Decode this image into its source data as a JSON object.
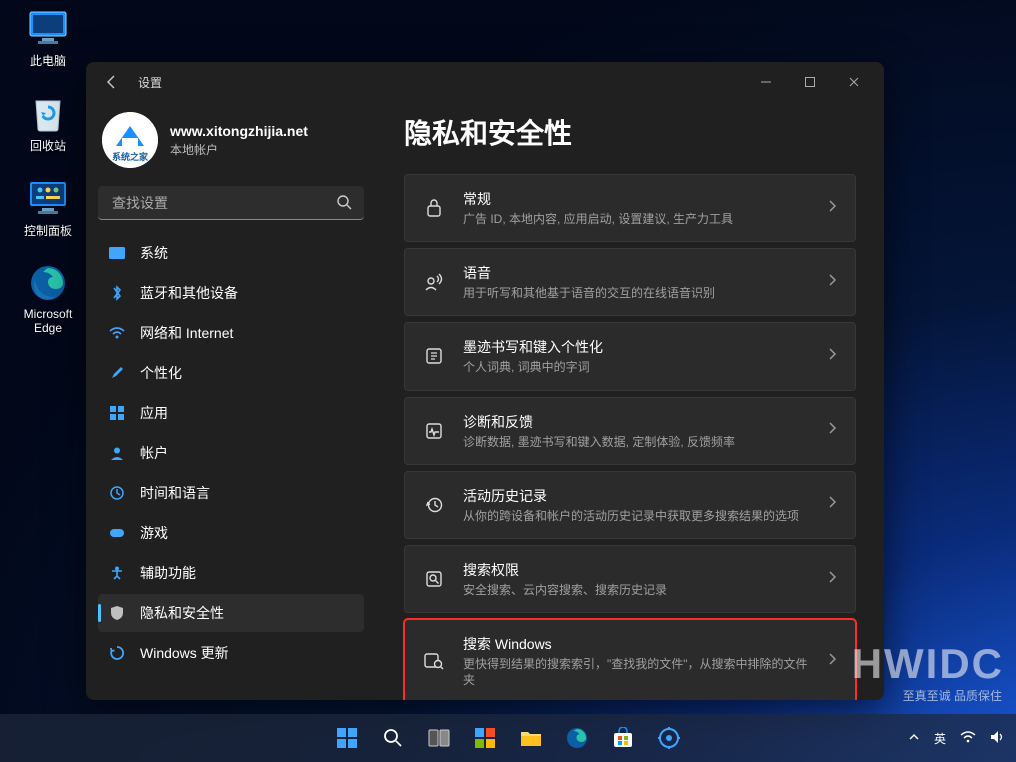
{
  "desktop": {
    "items": [
      {
        "name": "此电脑"
      },
      {
        "name": "回收站"
      },
      {
        "name": "控制面板"
      },
      {
        "name": "Microsoft Edge"
      }
    ]
  },
  "window": {
    "title": "设置",
    "account": {
      "username": "www.xitongzhijia.net",
      "type": "本地帐户"
    },
    "search_placeholder": "查找设置"
  },
  "sidebar": {
    "items": [
      {
        "label": "系统"
      },
      {
        "label": "蓝牙和其他设备"
      },
      {
        "label": "网络和 Internet"
      },
      {
        "label": "个性化"
      },
      {
        "label": "应用"
      },
      {
        "label": "帐户"
      },
      {
        "label": "时间和语言"
      },
      {
        "label": "游戏"
      },
      {
        "label": "辅助功能"
      },
      {
        "label": "隐私和安全性"
      },
      {
        "label": "Windows 更新"
      }
    ]
  },
  "main": {
    "heading": "隐私和安全性",
    "cards": [
      {
        "title": "常规",
        "sub": "广告 ID, 本地内容, 应用启动, 设置建议, 生产力工具"
      },
      {
        "title": "语音",
        "sub": "用于听写和其他基于语音的交互的在线语音识别"
      },
      {
        "title": "墨迹书写和键入个性化",
        "sub": "个人词典, 词典中的字词"
      },
      {
        "title": "诊断和反馈",
        "sub": "诊断数据, 墨迹书写和键入数据, 定制体验, 反馈频率"
      },
      {
        "title": "活动历史记录",
        "sub": "从你的跨设备和帐户的活动历史记录中获取更多搜索结果的选项"
      },
      {
        "title": "搜索权限",
        "sub": "安全搜索、云内容搜索、搜索历史记录"
      },
      {
        "title": "搜索 Windows",
        "sub": "更快得到结果的搜索索引，\"查找我的文件\"，从搜索中排除的文件夹"
      }
    ]
  },
  "taskbar": {
    "ime": "英"
  },
  "watermark": {
    "big": "HWIDC",
    "small": "至真至诚 品质保住"
  }
}
